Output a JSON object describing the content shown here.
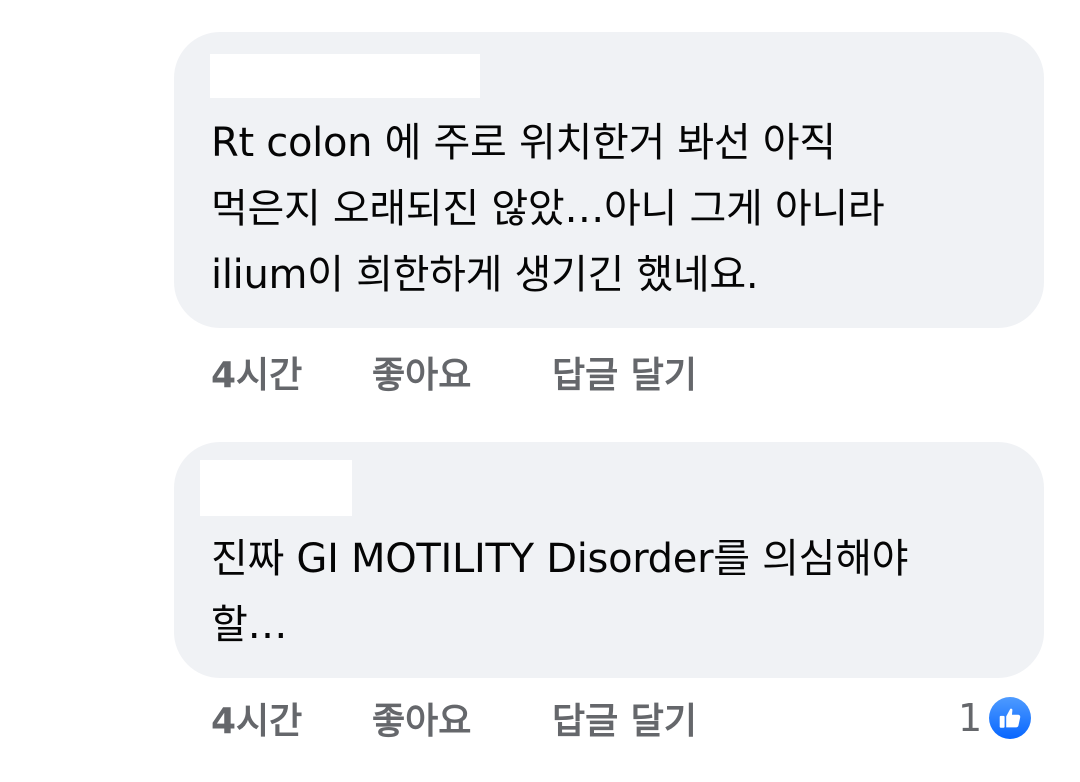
{
  "comments": [
    {
      "lines": [
        "Rt colon 에 주로 위치한거 봐선 아직",
        "먹은지 오래되진 않았…아니 그게 아니라",
        "ilium이 희한하게 생기긴 했네요."
      ],
      "time": "4시간",
      "like_label": "좋아요",
      "reply_label": "답글 달기"
    },
    {
      "lines": [
        "진짜 GI MOTILITY Disorder를 의심해야",
        "할…"
      ],
      "time": "4시간",
      "like_label": "좋아요",
      "reply_label": "답글 달기",
      "reaction_count": "1",
      "reaction_icon": "thumbs-up-icon",
      "reaction_color": "#1877f2"
    }
  ]
}
